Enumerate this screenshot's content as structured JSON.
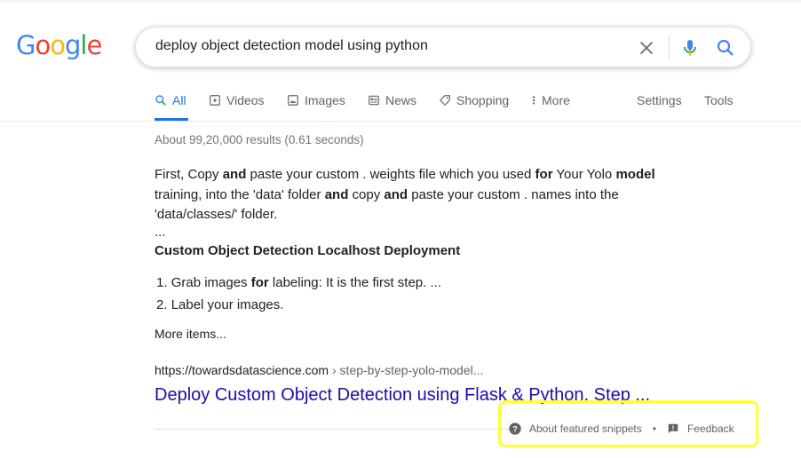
{
  "logo": {
    "letters": [
      "G",
      "o",
      "o",
      "g",
      "l",
      "e"
    ],
    "colors": [
      "#4285f4",
      "#ea4335",
      "#fbbc05",
      "#4285f4",
      "#34a853",
      "#ea4335"
    ]
  },
  "search": {
    "query": "deploy object detection model using python",
    "icons": [
      "clear-icon",
      "mic-icon",
      "search-icon"
    ]
  },
  "tabs": {
    "all": "All",
    "videos": "Videos",
    "images": "Images",
    "news": "News",
    "shopping": "Shopping",
    "more": "More",
    "settings": "Settings",
    "tools": "Tools",
    "active_color": "#1a73e8"
  },
  "stats": "About 99,20,000 results (0.61 seconds)",
  "snippet": {
    "line1": [
      "First, Copy ",
      "and",
      " paste your custom . weights file which you used ",
      "for",
      " Your Yolo ",
      "model"
    ],
    "line2": [
      "training, into the 'data' folder ",
      "and",
      " copy ",
      "and",
      " paste your custom . names into the"
    ],
    "line3": "'data/classes/' folder.",
    "ellipsis": "...",
    "heading": "Custom Object Detection Localhost Deployment",
    "list": [
      {
        "num": "1.",
        "pre": "Grab images ",
        "bold": "for",
        "post": " labeling: It is the first step. ..."
      },
      {
        "num": "2.",
        "pre": "Label your images.",
        "bold": "",
        "post": ""
      }
    ],
    "more_items": "More items..."
  },
  "result": {
    "url_domain": "https://towardsdatascience.com",
    "url_path": " › step-by-step-yolo-model...",
    "title": "Deploy Custom Object Detection using Flask & Python, Step ..."
  },
  "footer": {
    "about": "About featured snippets",
    "separator": "•",
    "feedback": "Feedback",
    "highlight_color": "#ffff33"
  }
}
